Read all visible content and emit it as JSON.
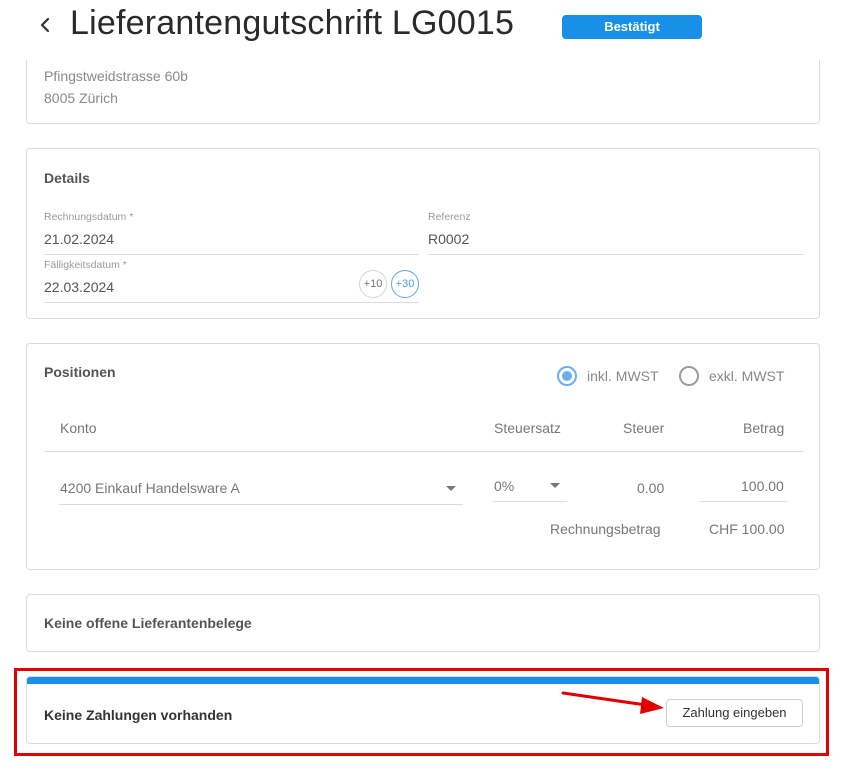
{
  "header": {
    "title": "Lieferantengutschrift LG0015",
    "status": "Bestätigt",
    "back_icon": "chevron-left-icon"
  },
  "address": {
    "street": "Pfingstweidstrasse 60b",
    "city": "8005 Zürich"
  },
  "details": {
    "title": "Details",
    "invoice_date_label": "Rechnungsdatum *",
    "invoice_date": "21.02.2024",
    "reference_label": "Referenz",
    "reference": "R0002",
    "due_date_label": "Fälligkeitsdatum *",
    "due_date": "22.03.2024",
    "plus10": "+10",
    "plus30": "+30"
  },
  "positions": {
    "title": "Positionen",
    "incl_vat": "inkl. MWST",
    "excl_vat": "exkl. MWST",
    "vat_mode": "inkl. MWST",
    "columns": [
      "Konto",
      "Steuersatz",
      "Steuer",
      "Betrag"
    ],
    "rows": [
      {
        "account": "4200 Einkauf Handelsware A",
        "tax_rate": "0%",
        "tax": "0.00",
        "amount": "100.00"
      }
    ],
    "total_label": "Rechnungsbetrag",
    "total_value": "CHF 100.00"
  },
  "open_items": {
    "title": "Keine offene Lieferantenbelege"
  },
  "payments": {
    "title": "Keine Zahlungen vorhanden",
    "button": "Zahlung eingeben"
  },
  "colors": {
    "accent": "#1a8fe8",
    "highlight": "#e00000",
    "radio_selected": "#6ab0ee"
  }
}
